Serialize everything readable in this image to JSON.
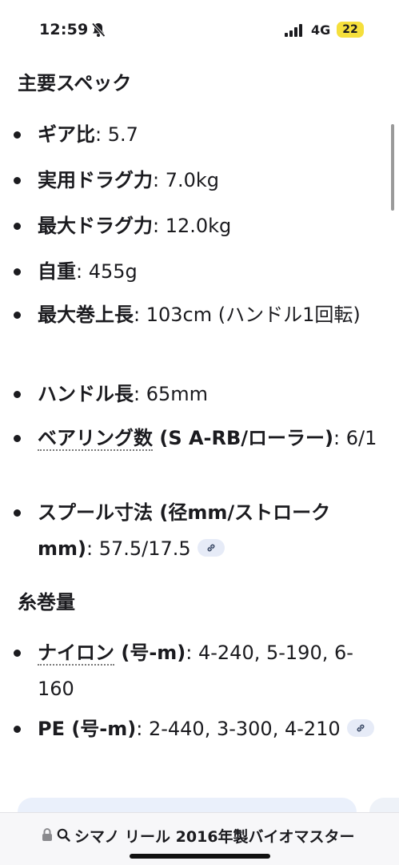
{
  "status_bar": {
    "time": "12:59",
    "network": "4G",
    "battery": "22",
    "battery_color": "#f5df3c"
  },
  "sections": {
    "main_specs": {
      "heading": "主要スペック",
      "items": [
        {
          "label": "ギア比",
          "value": ": 5.7"
        },
        {
          "label": "実用ドラグ力",
          "value": ": 7.0kg"
        },
        {
          "label": "最大ドラグ力",
          "value": ": 12.0kg"
        },
        {
          "label": "自重",
          "value": ": 455g"
        },
        {
          "label": "最大巻上長",
          "value": ": 103cm (ハンドル1回転)"
        },
        {
          "label": "ハンドル長",
          "value": ": 65mm"
        },
        {
          "label_link": "ベアリング数",
          "label_rest": " (S A-RB/ローラー)",
          "value": ": 6/1"
        },
        {
          "label": "スプール寸法 (径mm/ストロークmm)",
          "value": ": 57.5/17.5"
        }
      ]
    },
    "line_capacity": {
      "heading": "糸巻量",
      "items": [
        {
          "label_link": "ナイロン",
          "label_rest": " (号-m)",
          "value": ": 4-240, 5-190, 6-160"
        },
        {
          "label": "PE (号-m)",
          "value": ": 2-440, 3-300, 4-210"
        }
      ]
    }
  },
  "address_bar": {
    "query": "シマノ リール 2016年製バイオマスター"
  },
  "icons": {
    "status": [
      "bell-slash-icon",
      "signal-icon"
    ],
    "address": [
      "lock-icon",
      "search-icon"
    ],
    "inline": [
      "link-icon"
    ]
  }
}
